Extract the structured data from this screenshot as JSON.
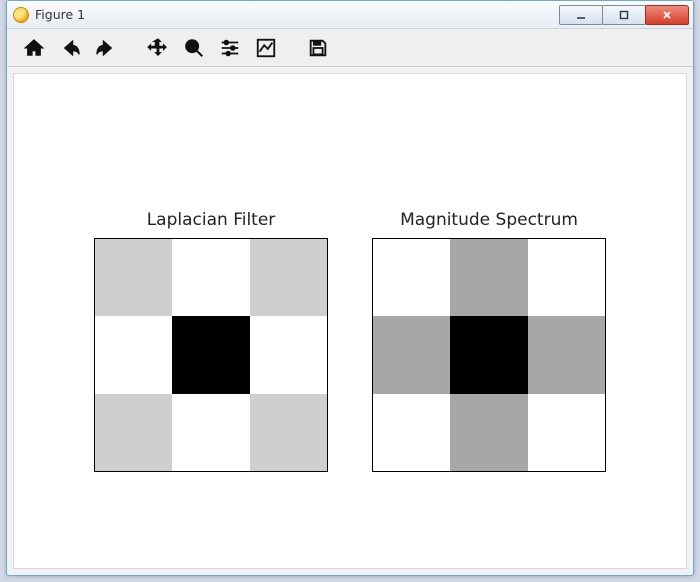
{
  "window": {
    "title": "Figure 1"
  },
  "toolbar": {
    "home": "Home",
    "back": "Back",
    "forward": "Forward",
    "pan": "Pan",
    "zoom": "Zoom",
    "subplots": "Configure subplots",
    "edit": "Edit axis",
    "save": "Save"
  },
  "colormap": {
    "0.0": "#000000",
    "0.45": "#a7a7a7",
    "0.7": "#cfcfcf",
    "1.0": "#ffffff"
  },
  "chart_data": [
    {
      "type": "heatmap",
      "title": "Laplacian Filter",
      "rows": 3,
      "cols": 3,
      "values": [
        [
          0.7,
          1.0,
          0.7
        ],
        [
          1.0,
          0.0,
          1.0
        ],
        [
          0.7,
          1.0,
          0.7
        ]
      ],
      "xticks": [],
      "yticks": []
    },
    {
      "type": "heatmap",
      "title": "Magnitude Spectrum",
      "rows": 3,
      "cols": 3,
      "values": [
        [
          1.0,
          0.45,
          1.0
        ],
        [
          0.45,
          0.0,
          0.45
        ],
        [
          1.0,
          0.45,
          1.0
        ]
      ],
      "xticks": [],
      "yticks": []
    }
  ]
}
